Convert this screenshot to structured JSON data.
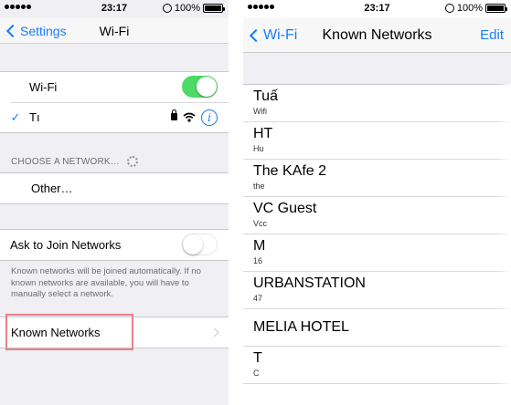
{
  "left": {
    "status": {
      "time": "23:17",
      "battery": "100%"
    },
    "nav": {
      "back_label": "Settings",
      "title": "Wi-Fi"
    },
    "wifi_row": {
      "label": "Wi-Fi",
      "enabled": true
    },
    "connected_network": {
      "name": "Tı"
    },
    "choose_header": "CHOOSE A NETWORK…",
    "other_label": "Other…",
    "ask_to_join": {
      "label": "Ask to Join Networks",
      "enabled": false
    },
    "footnote": "Known networks will be joined automatically. If no known networks are available, you will have to manually select a network.",
    "known_networks_label": "Known Networks",
    "highlight_color": "#e8808a"
  },
  "right": {
    "status": {
      "time": "23:17",
      "battery": "100%"
    },
    "nav": {
      "back_label": "Wi-Fi",
      "title": "Known Networks",
      "edit_label": "Edit"
    },
    "networks": [
      {
        "name": "Tuấ",
        "sub": "Wifi"
      },
      {
        "name": "HT",
        "sub": "Hu"
      },
      {
        "name": "The KAfe 2",
        "sub": "the"
      },
      {
        "name": "VC Guest",
        "sub": "Vcc"
      },
      {
        "name": "M",
        "sub": "16"
      },
      {
        "name": "URBANSTATION",
        "sub": "47"
      },
      {
        "name": "MELIA HOTEL",
        "sub": ""
      },
      {
        "name": "T",
        "sub": "C"
      }
    ]
  },
  "colors": {
    "accent": "#1a7cf5",
    "toggle_on": "#4cd964",
    "group_bg": "#efeff4"
  }
}
